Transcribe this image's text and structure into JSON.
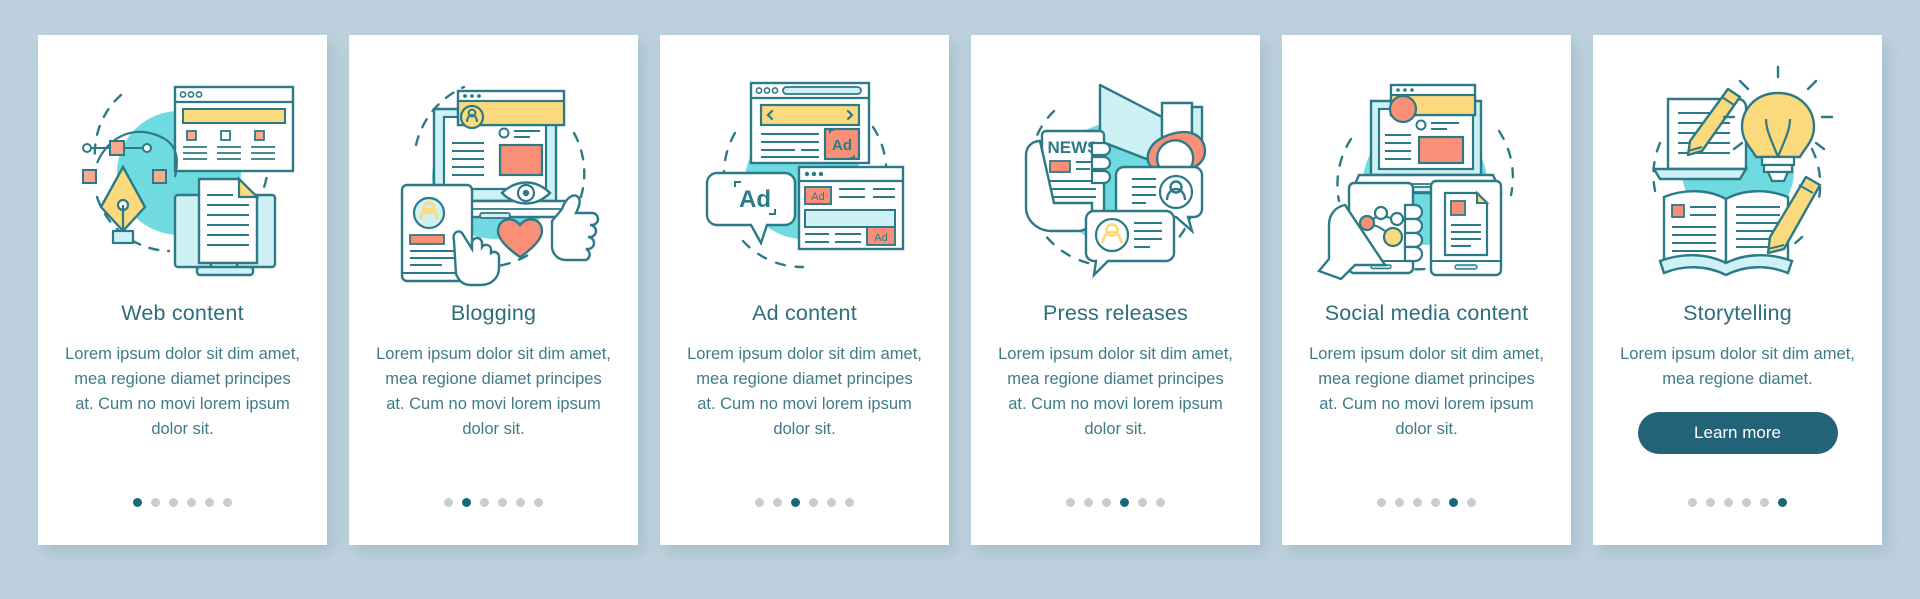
{
  "page": {
    "background_color": "#bdd2de",
    "card_background": "#ffffff",
    "accent_color": "#236377",
    "title_color": "#2d6d7c",
    "body_color": "#3f7b86",
    "dot_active_color": "#16687f",
    "dot_inactive_color": "#c9cdd0",
    "illustration_colors": {
      "teal_line": "#2c7a87",
      "cyan_fill": "#6fdbe0",
      "light_cyan": "#cdf1f4",
      "yellow": "#fbd97d",
      "coral": "#f98f76"
    }
  },
  "total_steps": 6,
  "cards": [
    {
      "title": "Web content",
      "description": "Lorem ipsum dolor sit dim amet, mea regione diamet principes at. Cum no movi lorem ipsum dolor sit.",
      "active_step": 1,
      "illustration": "web-content-illustration",
      "has_button": false
    },
    {
      "title": "Blogging",
      "description": "Lorem ipsum dolor sit dim amet, mea regione diamet principes at. Cum no movi lorem ipsum dolor sit.",
      "active_step": 2,
      "illustration": "blogging-illustration",
      "has_button": false
    },
    {
      "title": "Ad content",
      "description": "Lorem ipsum dolor sit dim amet, mea regione diamet principes at. Cum no movi lorem ipsum dolor sit.",
      "active_step": 3,
      "illustration": "ad-content-illustration",
      "has_button": false
    },
    {
      "title": "Press releases",
      "description": "Lorem ipsum dolor sit dim amet, mea regione diamet principes at. Cum no movi lorem ipsum dolor sit.",
      "active_step": 4,
      "illustration": "press-releases-illustration",
      "has_button": false
    },
    {
      "title": "Social media content",
      "description": "Lorem ipsum dolor sit dim amet, mea regione diamet principes at. Cum no movi lorem ipsum dolor sit.",
      "active_step": 5,
      "illustration": "social-media-illustration",
      "has_button": false
    },
    {
      "title": "Storytelling",
      "description": "Lorem ipsum dolor sit dim amet, mea regione diamet.",
      "active_step": 6,
      "illustration": "storytelling-illustration",
      "has_button": true,
      "button_label": "Learn more"
    }
  ],
  "illustration_text": {
    "news_label": "NEWS",
    "ad_label": "Ad"
  }
}
